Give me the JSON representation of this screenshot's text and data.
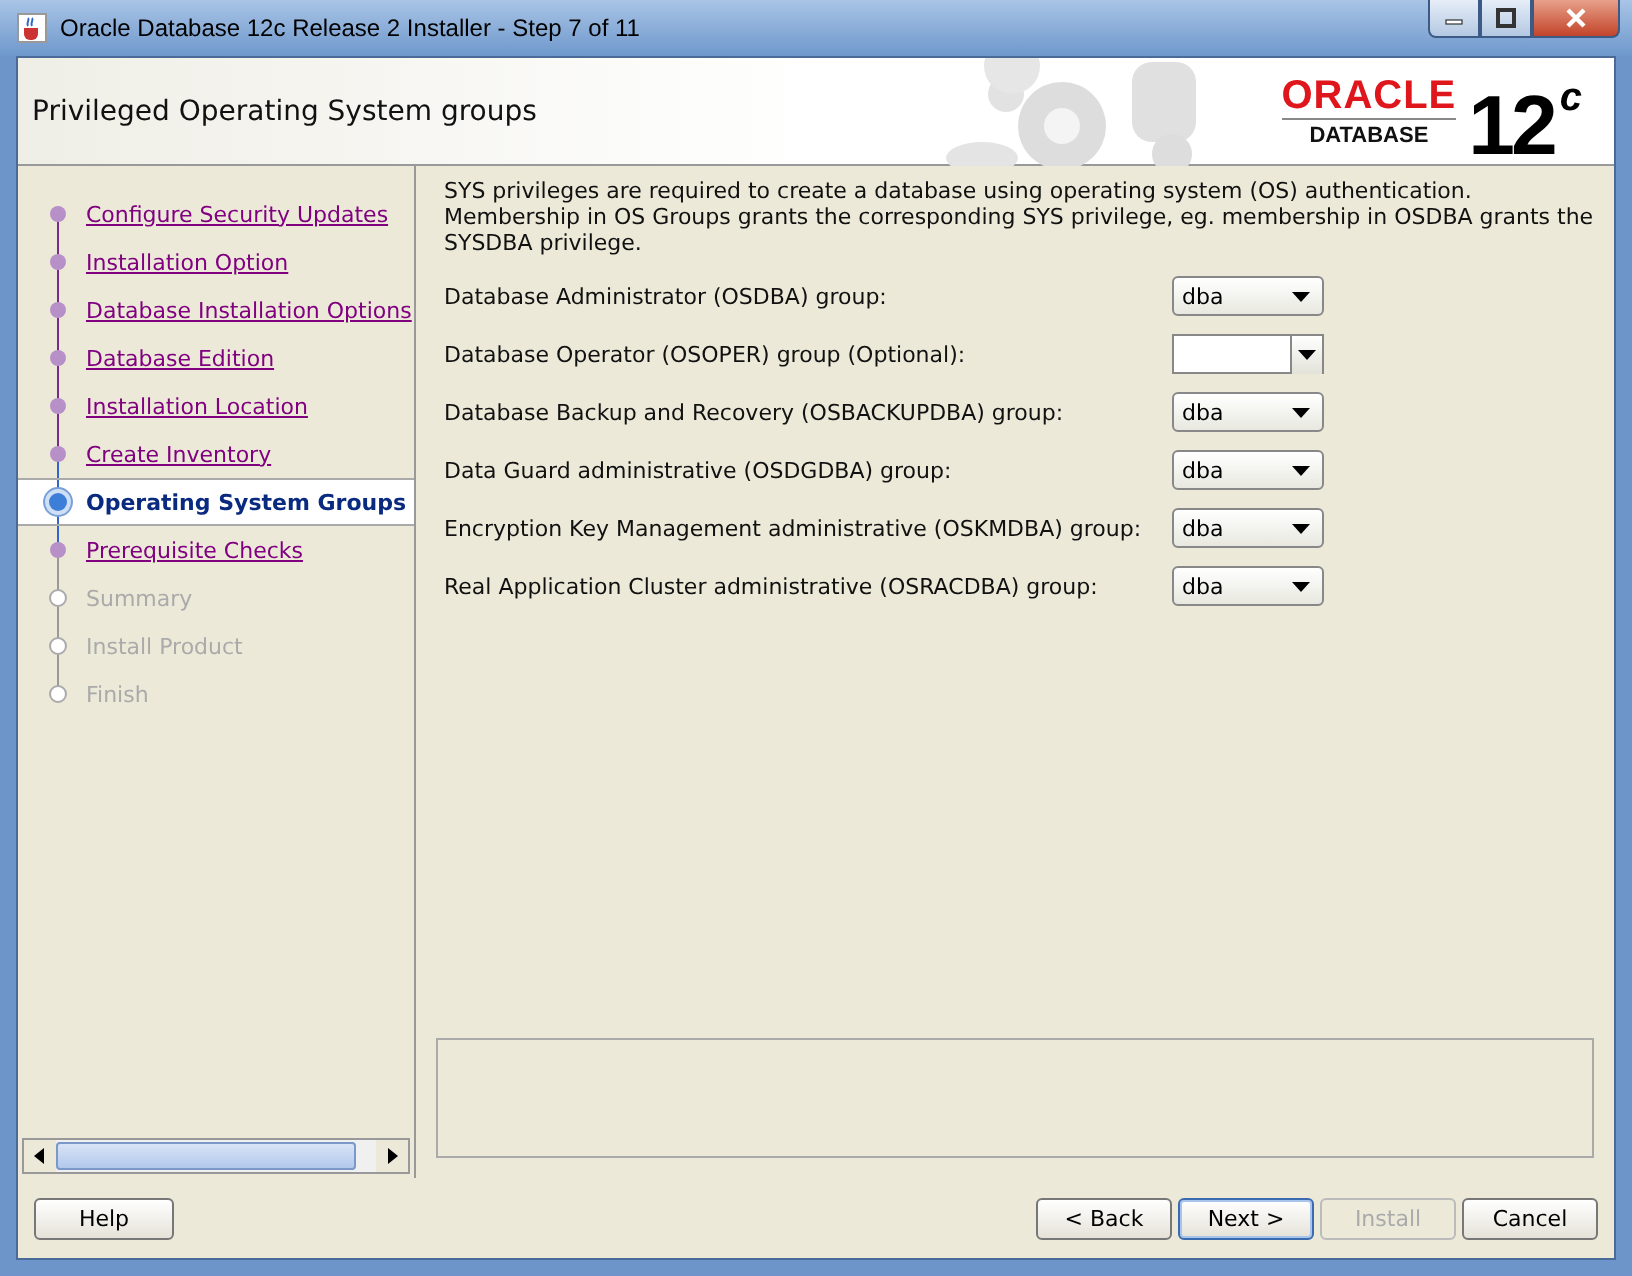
{
  "window": {
    "title": "Oracle Database 12c Release 2 Installer - Step 7 of 11"
  },
  "header": {
    "title": "Privileged Operating System groups",
    "logo_brand": "ORACLE",
    "logo_product": "DATABASE",
    "logo_version": "12",
    "logo_suffix": "c"
  },
  "steps": [
    {
      "label": "Configure Security Updates",
      "selected": false,
      "disabled": false
    },
    {
      "label": "Installation Option",
      "selected": false,
      "disabled": false
    },
    {
      "label": "Database Installation Options",
      "selected": false,
      "disabled": false
    },
    {
      "label": "Database Edition",
      "selected": false,
      "disabled": false
    },
    {
      "label": "Installation Location",
      "selected": false,
      "disabled": false
    },
    {
      "label": "Create Inventory",
      "selected": false,
      "disabled": false
    },
    {
      "label": "Operating System Groups",
      "selected": true,
      "disabled": false
    },
    {
      "label": "Prerequisite Checks",
      "selected": false,
      "disabled": false
    },
    {
      "label": "Summary",
      "selected": false,
      "disabled": true
    },
    {
      "label": "Install Product",
      "selected": false,
      "disabled": true
    },
    {
      "label": "Finish",
      "selected": false,
      "disabled": true
    }
  ],
  "intro": "SYS privileges are required to create a database using operating system (OS) authentication. Membership in OS Groups grants the corresponding SYS privilege, eg. membership in OSDBA grants the SYSDBA privilege.",
  "groups": [
    {
      "label": "Database Administrator (OSDBA) group:",
      "value": "dba"
    },
    {
      "label": "Database Operator (OSOPER) group (Optional):"
    },
    {
      "label": "Database Backup and Recovery (OSBACKUPDBA) group:",
      "value": "dba"
    },
    {
      "label": "Data Guard administrative (OSDGDBA) group:",
      "value": "dba"
    },
    {
      "label": "Encryption Key Management administrative (OSKMDBA) group:",
      "value": "dba"
    },
    {
      "label": "Real Application Cluster administrative (OSRACDBA) group:",
      "value": "dba"
    }
  ],
  "buttons": [
    {
      "label": "Help",
      "disabled": false
    },
    {
      "label": "< Back",
      "disabled": false
    },
    {
      "label": "Next >",
      "disabled": false
    },
    {
      "label": "Install",
      "disabled": true
    },
    {
      "label": "Cancel",
      "disabled": false
    }
  ]
}
